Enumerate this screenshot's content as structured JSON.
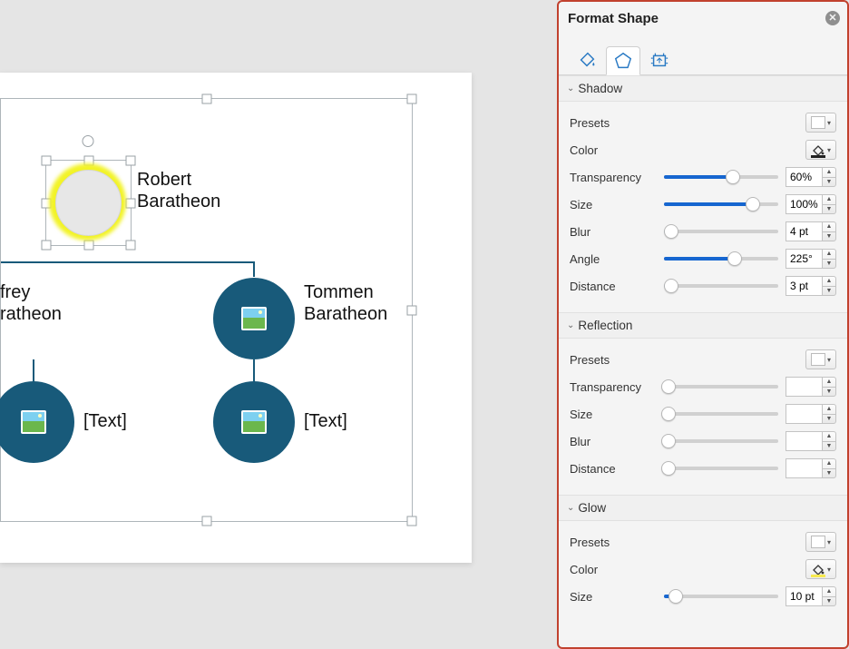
{
  "panel": {
    "title": "Format Shape",
    "tabs": {
      "fill": "fill-line-icon",
      "effects": "effects-icon",
      "size": "size-props-icon"
    }
  },
  "diagram": {
    "root_label": "Robert\nBaratheon",
    "left_label": "frey\nratheon",
    "middle_label": "Tommen\nBaratheon",
    "placeholder": "[Text]"
  },
  "shadow": {
    "title": "Shadow",
    "presets_label": "Presets",
    "color_label": "Color",
    "transparency_label": "Transparency",
    "size_label": "Size",
    "blur_label": "Blur",
    "angle_label": "Angle",
    "distance_label": "Distance",
    "transparency_value": "60%",
    "size_value": "100%",
    "blur_value": "4 pt",
    "angle_value": "225°",
    "distance_value": "3 pt",
    "transparency_pct": 60,
    "size_pct": 78,
    "blur_pct": 6,
    "angle_pct": 62,
    "distance_pct": 6
  },
  "reflection": {
    "title": "Reflection",
    "presets_label": "Presets",
    "transparency_label": "Transparency",
    "size_label": "Size",
    "blur_label": "Blur",
    "distance_label": "Distance"
  },
  "glow": {
    "title": "Glow",
    "presets_label": "Presets",
    "color_label": "Color",
    "size_label": "Size",
    "size_value": "10 pt",
    "size_pct": 10
  }
}
